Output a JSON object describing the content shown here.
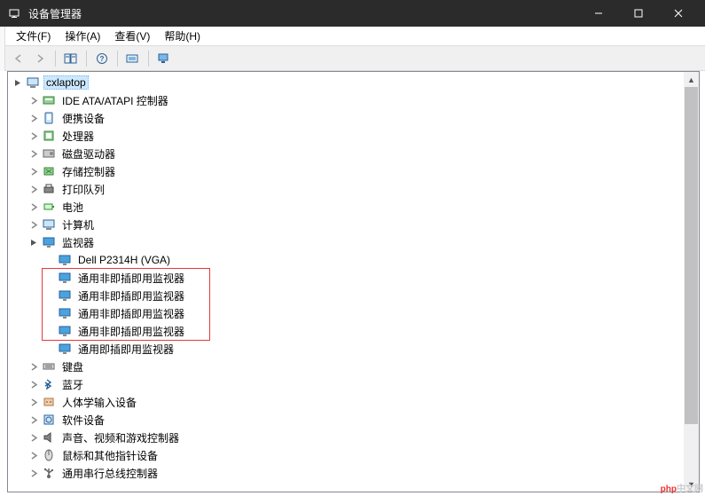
{
  "window": {
    "title": "设备管理器"
  },
  "menu": {
    "file": "文件(F)",
    "action": "操作(A)",
    "view": "查看(V)",
    "help": "帮助(H)"
  },
  "tree": {
    "root": "cxlaptop",
    "categories": [
      {
        "label": "IDE ATA/ATAPI 控制器",
        "icon": "ide"
      },
      {
        "label": "便携设备",
        "icon": "portable"
      },
      {
        "label": "处理器",
        "icon": "cpu"
      },
      {
        "label": "磁盘驱动器",
        "icon": "disk"
      },
      {
        "label": "存储控制器",
        "icon": "storage"
      },
      {
        "label": "打印队列",
        "icon": "printer"
      },
      {
        "label": "电池",
        "icon": "battery"
      },
      {
        "label": "计算机",
        "icon": "computer"
      }
    ],
    "monitors": {
      "label": "监视器",
      "children": [
        "Dell P2314H (VGA)",
        "通用非即插即用监视器",
        "通用非即插即用监视器",
        "通用非即插即用监视器",
        "通用非即插即用监视器",
        "通用即插即用监视器"
      ]
    },
    "after": [
      {
        "label": "键盘",
        "icon": "keyboard"
      },
      {
        "label": "蓝牙",
        "icon": "bluetooth"
      },
      {
        "label": "人体学输入设备",
        "icon": "hid"
      },
      {
        "label": "软件设备",
        "icon": "software"
      },
      {
        "label": "声音、视频和游戏控制器",
        "icon": "sound"
      },
      {
        "label": "鼠标和其他指针设备",
        "icon": "mouse"
      },
      {
        "label": "通用串行总线控制器",
        "icon": "usb"
      }
    ]
  },
  "watermark": "php中文网"
}
